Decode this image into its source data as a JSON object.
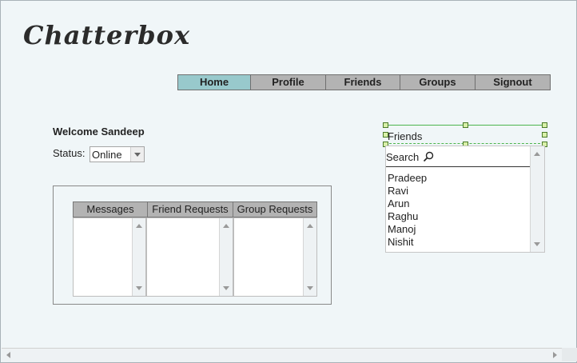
{
  "app": {
    "logo": "Chatterbox"
  },
  "nav": {
    "items": [
      "Home",
      "Profile",
      "Friends",
      "Groups",
      "Signout"
    ],
    "active": "Home"
  },
  "welcome": {
    "text": "Welcome Sandeep"
  },
  "status": {
    "label": "Status:",
    "value": "Online"
  },
  "tabs": [
    "Messages",
    "Friend Requests",
    "Group Requests"
  ],
  "friends": {
    "title": "Friends",
    "search_label": "Search",
    "list": [
      "Pradeep",
      "Ravi",
      "Arun",
      "Raghu",
      "Manoj",
      "Nishit"
    ]
  },
  "colors": {
    "active_tab": "#98c9cc",
    "tab_bg": "#b3b3b3",
    "page_bg": "#f0f6f8",
    "selection": "#4db54d"
  }
}
